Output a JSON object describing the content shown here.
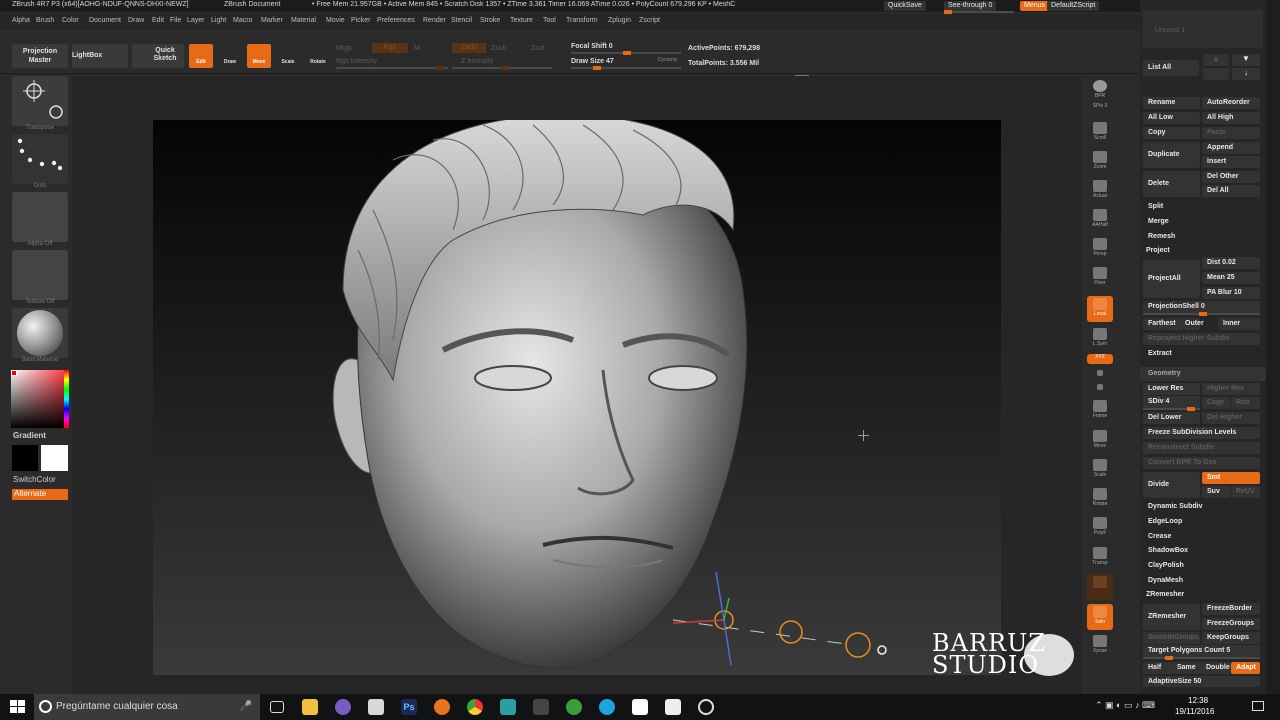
{
  "titlebar": {
    "app": "ZBrush 4R7 P3 (x64)[AOHG-NDUF-QNNS-DHXI-NEWZ]",
    "document": "ZBrush Document",
    "stats": "• Free Mem 21.957GB • Active Mem 845 • Scratch Disk 1357 • ZTime 3.361 Timer 16.069 ATime 0.026 • PolyCount 679.296 KP • MeshC",
    "quicksave": "QuickSave",
    "seethrough": "See-through  0",
    "menus": "Menus",
    "script": "DefaultZScript"
  },
  "menubar": [
    "Alpha",
    "Brush",
    "Color",
    "Document",
    "Draw",
    "Edit",
    "File",
    "Layer",
    "Light",
    "Macro",
    "Marker",
    "Material",
    "Movie",
    "Picker",
    "Preferences",
    "Render",
    "Stencil",
    "Stroke",
    "Texture",
    "Tool",
    "Transform",
    "Zplugin",
    "Zscript"
  ],
  "shelf": {
    "projection_master": "Projection Master",
    "lightbox": "LightBox",
    "quick_sketch": "Quick Sketch",
    "edit": "Edit",
    "draw": "Draw",
    "move": "Move",
    "scale": "Scale",
    "rotate": "Rotate",
    "mrgb": "Mrgb",
    "rgb": "Rgb",
    "m": "M",
    "zadd": "Zadd",
    "zsub": "Zsub",
    "zcut": "Zcut",
    "rgb_intensity": "Rgb Intensity",
    "z_intensity": "Z Intensity",
    "focal_shift": "Focal Shift 0",
    "draw_size": "Draw Size 47",
    "dynamic": "Dynamic",
    "active_points": "ActivePoints: 679,298",
    "total_points": "TotalPoints: 3.556 Mil"
  },
  "leftpanel": {
    "transpose": "Transpose",
    "dots": "Dots",
    "alpha_off": "Alpha Off",
    "texture_off": "Texture Off",
    "material": "BasicMaterial",
    "gradient": "Gradient",
    "switchcolor": "SwitchColor",
    "alternate": "Alternate"
  },
  "righttools": [
    "BPR",
    "SPix 3",
    "Scroll",
    "Zoom",
    "Actual",
    "AAHalf",
    "Persp",
    "Floor",
    "Local",
    "L.Sym",
    "XYZ",
    "",
    "",
    "Frame",
    "Move",
    "Scale",
    "Rotate",
    "PolyF",
    "Transp",
    "",
    "Solo",
    "Xpose"
  ],
  "subtool": {
    "list_all": "List All",
    "rename": "Rename",
    "autoreorder": "AutoReorder",
    "all_low": "All Low",
    "all_high": "All High",
    "copy": "Copy",
    "paste": "Paste",
    "duplicate": "Duplicate",
    "append": "Append",
    "insert": "Insert",
    "delete": "Delete",
    "del_other": "Del Other",
    "del_all": "Del All",
    "split": "Split",
    "merge": "Merge",
    "remesh": "Remesh",
    "project": "Project",
    "project_all": "ProjectAll",
    "dist": "Dist 0.02",
    "mean": "Mean 25",
    "pa_blur": "PA Blur 10",
    "projection_shell": "ProjectionShell 0",
    "farthest": "Farthest",
    "outer": "Outer",
    "inner": "Inner",
    "reproject": "Reproject Higher Subdiv",
    "extract": "Extract",
    "unused": "Unused 1"
  },
  "geometry": {
    "title": "Geometry",
    "lower_res": "Lower Res",
    "higher_res": "Higher Res",
    "sdiv": "SDiv 4",
    "cage": "Cage",
    "rstr": "Rstr",
    "del_lower": "Del Lower",
    "del_higher": "Del Higher",
    "freeze_subdiv": "Freeze SubDivision Levels",
    "reconstruct": "Reconstruct Subdiv",
    "convert_bpr": "Convert BPR To Geo",
    "divide": "Divide",
    "smt": "Smt",
    "suv": "Suv",
    "reuv": "ReUV",
    "dynamic_subdiv": "Dynamic Subdiv",
    "edgeloop": "EdgeLoop",
    "crease": "Crease",
    "shadowbox": "ShadowBox",
    "claypolish": "ClayPolish",
    "dynamesh": "DynaMesh",
    "zremesher_title": "ZRemesher",
    "zremesher": "ZRemesher",
    "freezeborder": "FreezeBorder",
    "freezegroups": "FreezeGroups",
    "smoothgroups": "SmoothGroups",
    "keepgroups": "KeepGroups",
    "target_count": "Target Polygons Count 5",
    "half": "Half",
    "same": "Same",
    "double": "Double",
    "adapt": "Adapt",
    "adaptive_size": "AdaptiveSize 50"
  },
  "watermark": {
    "line1": "BARRUZ",
    "line2": "STUDIO"
  },
  "taskbar": {
    "search": "Pregúntame cualquier cosa",
    "time": "12:38",
    "date": "19/11/2016"
  },
  "colors": {
    "accent": "#e86a16",
    "panel": "#262626"
  }
}
